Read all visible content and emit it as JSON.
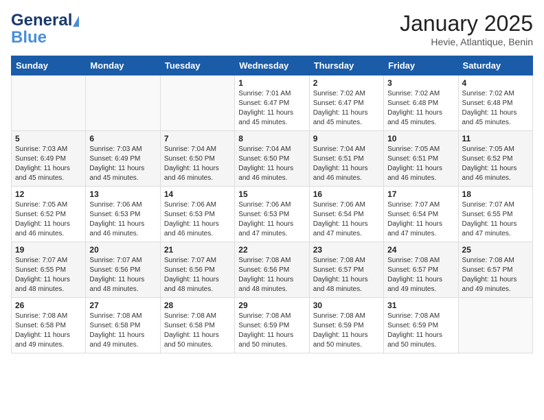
{
  "header": {
    "logo_line1": "General",
    "logo_line2": "Blue",
    "month_year": "January 2025",
    "location": "Hevie, Atlantique, Benin"
  },
  "weekdays": [
    "Sunday",
    "Monday",
    "Tuesday",
    "Wednesday",
    "Thursday",
    "Friday",
    "Saturday"
  ],
  "weeks": [
    [
      {
        "day": "",
        "info": ""
      },
      {
        "day": "",
        "info": ""
      },
      {
        "day": "",
        "info": ""
      },
      {
        "day": "1",
        "info": "Sunrise: 7:01 AM\nSunset: 6:47 PM\nDaylight: 11 hours\nand 45 minutes."
      },
      {
        "day": "2",
        "info": "Sunrise: 7:02 AM\nSunset: 6:47 PM\nDaylight: 11 hours\nand 45 minutes."
      },
      {
        "day": "3",
        "info": "Sunrise: 7:02 AM\nSunset: 6:48 PM\nDaylight: 11 hours\nand 45 minutes."
      },
      {
        "day": "4",
        "info": "Sunrise: 7:02 AM\nSunset: 6:48 PM\nDaylight: 11 hours\nand 45 minutes."
      }
    ],
    [
      {
        "day": "5",
        "info": "Sunrise: 7:03 AM\nSunset: 6:49 PM\nDaylight: 11 hours\nand 45 minutes."
      },
      {
        "day": "6",
        "info": "Sunrise: 7:03 AM\nSunset: 6:49 PM\nDaylight: 11 hours\nand 45 minutes."
      },
      {
        "day": "7",
        "info": "Sunrise: 7:04 AM\nSunset: 6:50 PM\nDaylight: 11 hours\nand 46 minutes."
      },
      {
        "day": "8",
        "info": "Sunrise: 7:04 AM\nSunset: 6:50 PM\nDaylight: 11 hours\nand 46 minutes."
      },
      {
        "day": "9",
        "info": "Sunrise: 7:04 AM\nSunset: 6:51 PM\nDaylight: 11 hours\nand 46 minutes."
      },
      {
        "day": "10",
        "info": "Sunrise: 7:05 AM\nSunset: 6:51 PM\nDaylight: 11 hours\nand 46 minutes."
      },
      {
        "day": "11",
        "info": "Sunrise: 7:05 AM\nSunset: 6:52 PM\nDaylight: 11 hours\nand 46 minutes."
      }
    ],
    [
      {
        "day": "12",
        "info": "Sunrise: 7:05 AM\nSunset: 6:52 PM\nDaylight: 11 hours\nand 46 minutes."
      },
      {
        "day": "13",
        "info": "Sunrise: 7:06 AM\nSunset: 6:53 PM\nDaylight: 11 hours\nand 46 minutes."
      },
      {
        "day": "14",
        "info": "Sunrise: 7:06 AM\nSunset: 6:53 PM\nDaylight: 11 hours\nand 46 minutes."
      },
      {
        "day": "15",
        "info": "Sunrise: 7:06 AM\nSunset: 6:53 PM\nDaylight: 11 hours\nand 47 minutes."
      },
      {
        "day": "16",
        "info": "Sunrise: 7:06 AM\nSunset: 6:54 PM\nDaylight: 11 hours\nand 47 minutes."
      },
      {
        "day": "17",
        "info": "Sunrise: 7:07 AM\nSunset: 6:54 PM\nDaylight: 11 hours\nand 47 minutes."
      },
      {
        "day": "18",
        "info": "Sunrise: 7:07 AM\nSunset: 6:55 PM\nDaylight: 11 hours\nand 47 minutes."
      }
    ],
    [
      {
        "day": "19",
        "info": "Sunrise: 7:07 AM\nSunset: 6:55 PM\nDaylight: 11 hours\nand 48 minutes."
      },
      {
        "day": "20",
        "info": "Sunrise: 7:07 AM\nSunset: 6:56 PM\nDaylight: 11 hours\nand 48 minutes."
      },
      {
        "day": "21",
        "info": "Sunrise: 7:07 AM\nSunset: 6:56 PM\nDaylight: 11 hours\nand 48 minutes."
      },
      {
        "day": "22",
        "info": "Sunrise: 7:08 AM\nSunset: 6:56 PM\nDaylight: 11 hours\nand 48 minutes."
      },
      {
        "day": "23",
        "info": "Sunrise: 7:08 AM\nSunset: 6:57 PM\nDaylight: 11 hours\nand 48 minutes."
      },
      {
        "day": "24",
        "info": "Sunrise: 7:08 AM\nSunset: 6:57 PM\nDaylight: 11 hours\nand 49 minutes."
      },
      {
        "day": "25",
        "info": "Sunrise: 7:08 AM\nSunset: 6:57 PM\nDaylight: 11 hours\nand 49 minutes."
      }
    ],
    [
      {
        "day": "26",
        "info": "Sunrise: 7:08 AM\nSunset: 6:58 PM\nDaylight: 11 hours\nand 49 minutes."
      },
      {
        "day": "27",
        "info": "Sunrise: 7:08 AM\nSunset: 6:58 PM\nDaylight: 11 hours\nand 49 minutes."
      },
      {
        "day": "28",
        "info": "Sunrise: 7:08 AM\nSunset: 6:58 PM\nDaylight: 11 hours\nand 50 minutes."
      },
      {
        "day": "29",
        "info": "Sunrise: 7:08 AM\nSunset: 6:59 PM\nDaylight: 11 hours\nand 50 minutes."
      },
      {
        "day": "30",
        "info": "Sunrise: 7:08 AM\nSunset: 6:59 PM\nDaylight: 11 hours\nand 50 minutes."
      },
      {
        "day": "31",
        "info": "Sunrise: 7:08 AM\nSunset: 6:59 PM\nDaylight: 11 hours\nand 50 minutes."
      },
      {
        "day": "",
        "info": ""
      }
    ]
  ]
}
